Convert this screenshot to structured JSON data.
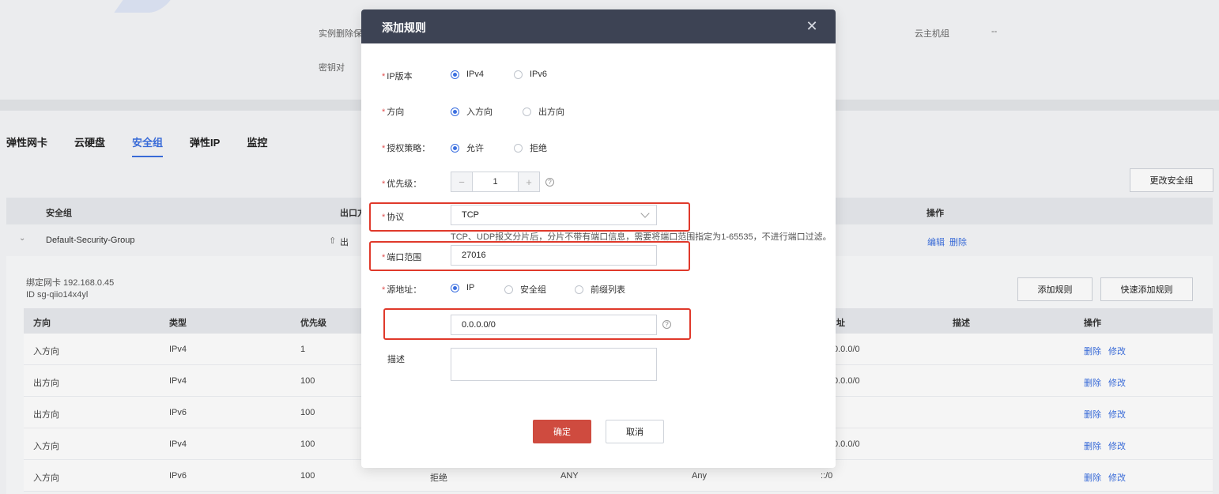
{
  "instance_info": {
    "delete_protect_label": "实例删除保",
    "key_pair_label": "密钥对",
    "host_group_label": "云主机组",
    "host_group_value": "--"
  },
  "tabs": [
    {
      "label": "弹性网卡"
    },
    {
      "label": "云硬盘"
    },
    {
      "label": "安全组"
    },
    {
      "label": "弹性IP"
    },
    {
      "label": "监控"
    }
  ],
  "change_sg_button": "更改安全组",
  "sg_table": {
    "headers": [
      "安全组",
      "出口方",
      "操作"
    ],
    "row": {
      "name": "Default-Security-Group",
      "direction_fragment": "出",
      "edit": "编辑",
      "delete": "删除"
    }
  },
  "bound_nic": "绑定网卡 192.168.0.45",
  "sg_id": "ID sg-qiio14x4yl",
  "add_rule_button": "添加规则",
  "quick_add_rule_button": "快速添加规则",
  "rules_table": {
    "headers": [
      "方向",
      "类型",
      "优先级",
      "描述",
      "操作"
    ],
    "header_fragment": "址",
    "rows": [
      {
        "direction": "入方向",
        "type": "IPv4",
        "priority": "1",
        "policy": "",
        "protocol": "",
        "port": "",
        "source": "0.0.0/0"
      },
      {
        "direction": "出方向",
        "type": "IPv4",
        "priority": "100",
        "policy": "",
        "protocol": "",
        "port": "",
        "source": "0.0.0/0"
      },
      {
        "direction": "出方向",
        "type": "IPv6",
        "priority": "100",
        "policy": "",
        "protocol": "",
        "port": "",
        "source": ""
      },
      {
        "direction": "入方向",
        "type": "IPv4",
        "priority": "100",
        "policy": "",
        "protocol": "",
        "port": "",
        "source": "0.0.0/0"
      },
      {
        "direction": "入方向",
        "type": "IPv6",
        "priority": "100",
        "policy": "拒绝",
        "protocol": "ANY",
        "port": "Any",
        "source": "::/0"
      }
    ],
    "delete_label": "删除",
    "modify_label": "修改"
  },
  "modal": {
    "title": "添加规则",
    "close_icon": "✕",
    "ip_version": {
      "label": "IP版本",
      "options": [
        "IPv4",
        "IPv6"
      ],
      "selected": "IPv4"
    },
    "direction": {
      "label": "方向",
      "options": [
        "入方向",
        "出方向"
      ],
      "selected": "入方向"
    },
    "policy": {
      "label": "授权策略：",
      "options": [
        "允许",
        "拒绝"
      ],
      "selected": "允许"
    },
    "priority": {
      "label": "优先级：",
      "value": "1",
      "minus": "−",
      "plus": "+"
    },
    "help_glyph": "?",
    "protocol": {
      "label": "协议",
      "value": "TCP",
      "hint": "TCP、UDP报文分片后，分片不带有端口信息，需要将端口范围指定为1-65535，不进行端口过滤。"
    },
    "port_range": {
      "label": "端口范围",
      "value": "27016"
    },
    "source": {
      "label": "源地址：",
      "options": [
        "IP",
        "安全组",
        "前缀列表"
      ],
      "selected": "IP",
      "value": "0.0.0.0/0"
    },
    "description": {
      "label": "描述",
      "value": ""
    },
    "confirm_label": "确定",
    "cancel_label": "取消"
  },
  "colors": {
    "accent": "#3b6fe0",
    "modal_header": "#3d4354",
    "primary_button": "#cf4b3f",
    "highlight": "#e0392b"
  }
}
